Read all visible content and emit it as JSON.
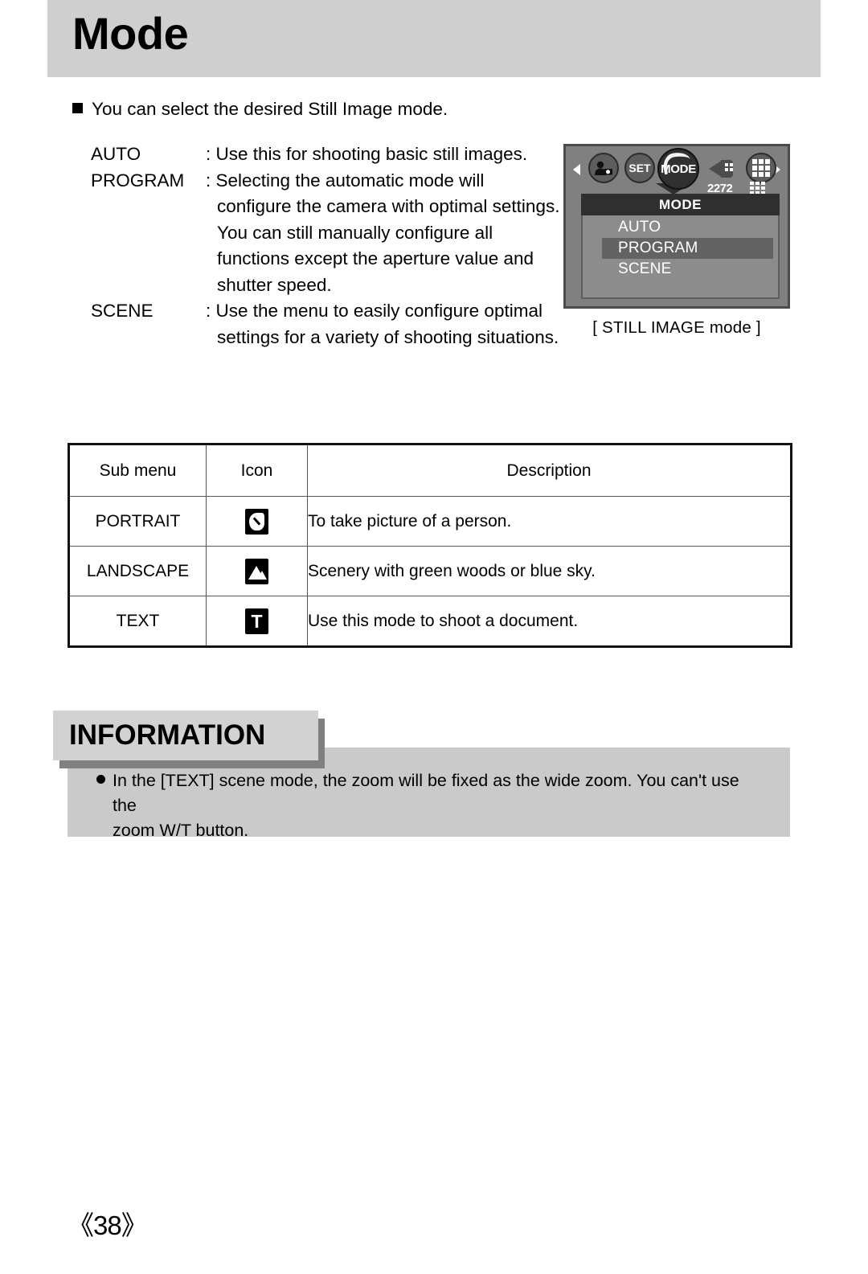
{
  "header": {
    "title": "Mode"
  },
  "intro": {
    "bullet_icon": "square-bullet-icon",
    "text": "You can select the desired Still Image mode."
  },
  "mode_list": [
    {
      "term": "AUTO",
      "lines": [
        ": Use this for shooting basic still images."
      ]
    },
    {
      "term": "PROGRAM",
      "lines": [
        ": Selecting the automatic mode will",
        "configure the camera with optimal settings.",
        "You can still manually configure all",
        "functions except the aperture value and",
        "shutter speed."
      ]
    },
    {
      "term": "SCENE",
      "lines": [
        ": Use the menu to easily configure optimal",
        "settings for a variety of shooting situations."
      ]
    }
  ],
  "lcd": {
    "caption": "[ STILL IMAGE mode ]",
    "icon_bar": {
      "left_arrow": "chevron-left-icon",
      "right_arrow": "chevron-right-icon",
      "icons": [
        {
          "name": "person-camera-icon",
          "label": ""
        },
        {
          "name": "set-icon",
          "label": "SET"
        },
        {
          "name": "mode-icon",
          "label": "MODE",
          "selected": true
        },
        {
          "name": "flash-icon",
          "label": ""
        },
        {
          "name": "grid-quality-icon",
          "label": ""
        }
      ],
      "resolution_label": "2272",
      "quality_grid_icon": "quality-grid-icon"
    },
    "menu": {
      "title": "MODE",
      "items": [
        {
          "label": "AUTO",
          "selected": false
        },
        {
          "label": "PROGRAM",
          "selected": true
        },
        {
          "label": "SCENE",
          "selected": false
        }
      ]
    },
    "colors": {
      "frame": "#808080",
      "frame_border": "#4b4b4b",
      "panel": "#8c8c8c",
      "title_bar": "#2f2f2f",
      "highlight": "#636363"
    }
  },
  "table": {
    "headers": [
      "Sub menu",
      "Icon",
      "Description"
    ],
    "rows": [
      {
        "sub_menu": "PORTRAIT",
        "icon": "portrait-icon",
        "icon_glyph": "",
        "description": "To take picture of a person."
      },
      {
        "sub_menu": "LANDSCAPE",
        "icon": "landscape-icon",
        "icon_glyph": "",
        "description": "Scenery with green woods or blue sky."
      },
      {
        "sub_menu": "TEXT",
        "icon": "text-icon",
        "icon_glyph": "T",
        "description": "Use this mode to shoot a document."
      }
    ]
  },
  "information": {
    "tab_label": "INFORMATION",
    "bullet_icon": "round-bullet-icon",
    "lines": [
      "In the [TEXT] scene mode, the zoom will be fixed as the wide zoom. You can't use the",
      "zoom W/T button."
    ]
  },
  "footer": {
    "page_number": "《38》"
  }
}
